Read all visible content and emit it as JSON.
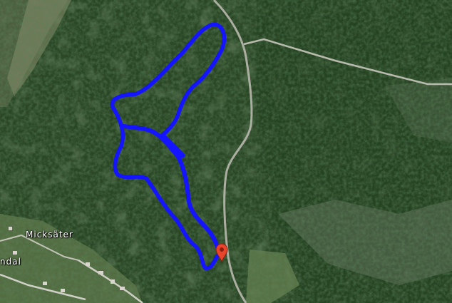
{
  "map": {
    "view": "satellite",
    "labels": [
      {
        "id": "micksater",
        "text": "Micksäter"
      },
      {
        "id": "ndal",
        "text": "ndal"
      }
    ],
    "route": {
      "color": "#1414ff"
    },
    "marker": {
      "icon": "map-pin-icon",
      "color": "#e8452c"
    },
    "colors": {
      "forest_dark": "#1f3a1c",
      "forest_mid": "#35532c",
      "clearing": "#8a8a6a",
      "road": "#cfcfc6"
    }
  }
}
